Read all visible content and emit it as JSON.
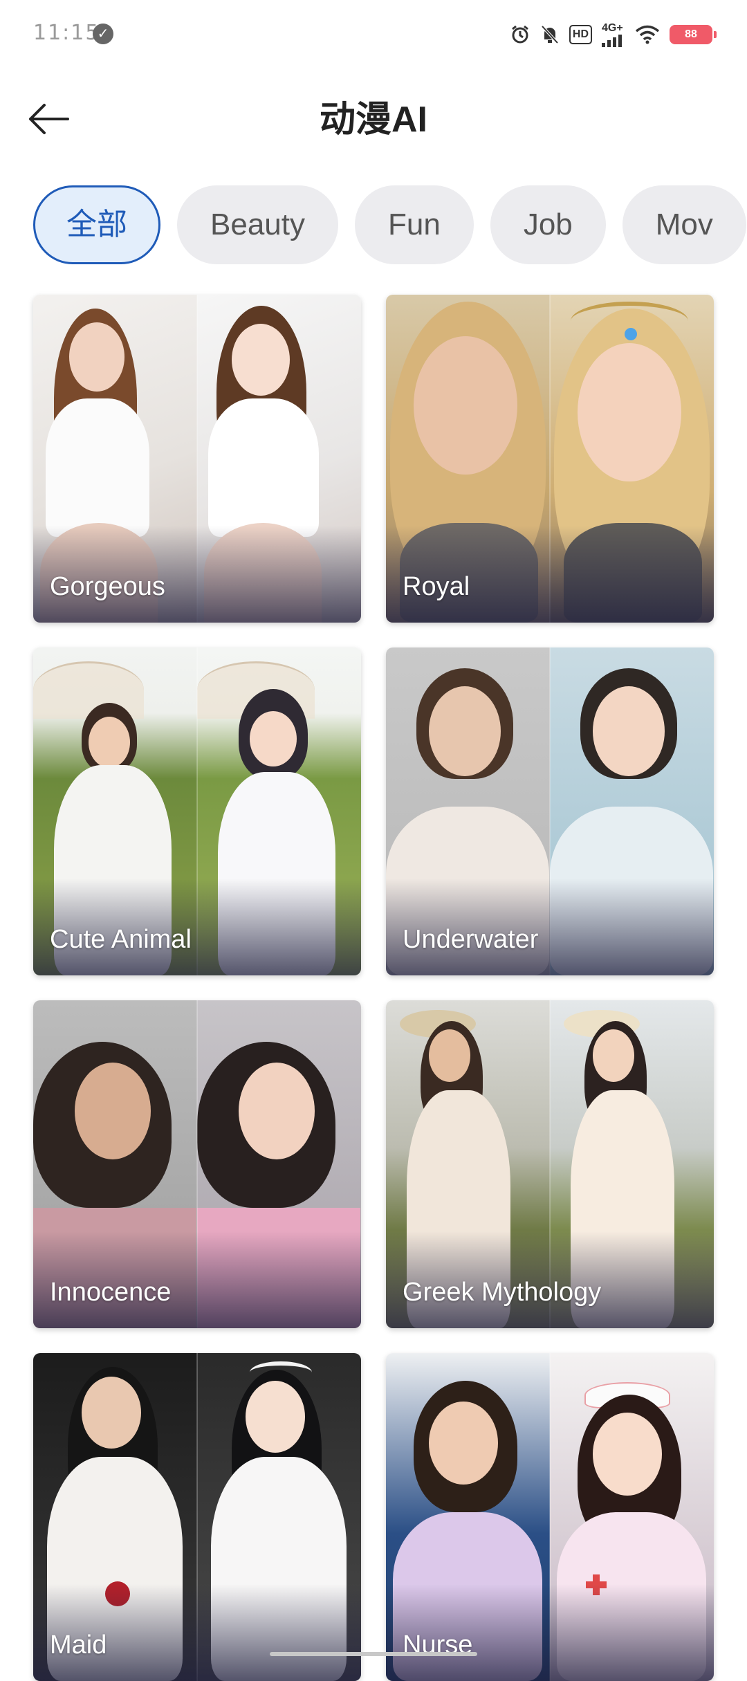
{
  "status_bar": {
    "time": "11:15",
    "network": "4G+",
    "hd": "HD",
    "battery": "88"
  },
  "header": {
    "title": "动漫AI"
  },
  "tabs": [
    {
      "label": "全部",
      "active": true
    },
    {
      "label": "Beauty",
      "active": false
    },
    {
      "label": "Fun",
      "active": false
    },
    {
      "label": "Job",
      "active": false
    },
    {
      "label": "Mov",
      "active": false
    }
  ],
  "cards": [
    {
      "label": "Gorgeous"
    },
    {
      "label": "Royal"
    },
    {
      "label": "Cute Animal"
    },
    {
      "label": "Underwater"
    },
    {
      "label": "Innocence"
    },
    {
      "label": "Greek Mythology"
    },
    {
      "label": "Maid"
    },
    {
      "label": "Nurse"
    }
  ],
  "colors": {
    "accent": "#1f5bb8",
    "tab_active_bg": "#e3eefb",
    "tab_bg": "#ececef",
    "battery": "#f05a68"
  }
}
